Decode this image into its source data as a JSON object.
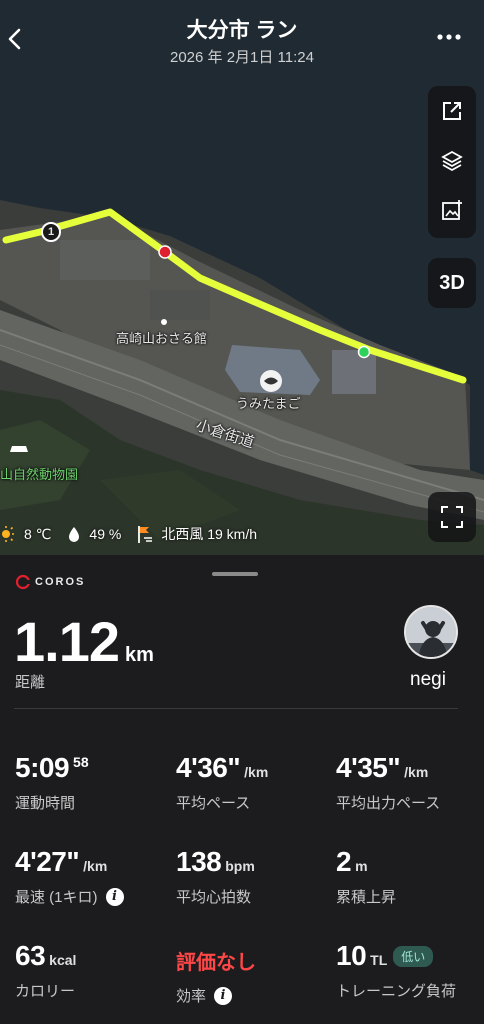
{
  "header": {
    "title": "大分市 ラン",
    "datetime": "2026 年 2月1日 11:24"
  },
  "map": {
    "labels": {
      "landmark": "高崎山おさる館",
      "aquarium": "うみたまご",
      "road": "小倉街道",
      "zoo": "山自然動物園"
    },
    "lap_marker": "1",
    "mode_button": "3D",
    "route_color": "#e6ff3b",
    "start_color": "#2ed25a",
    "end_color": "#e0202f"
  },
  "weather": {
    "temperature": "8 ℃",
    "humidity": "49 %",
    "wind": "北西風 19 km/h"
  },
  "panel": {
    "brand": "COROS",
    "distance": {
      "value": "1.12",
      "unit": "km",
      "label": "距離"
    },
    "user": {
      "name": "negi"
    },
    "stats": {
      "duration": {
        "value": "5:09",
        "sup": "58",
        "label": "運動時間"
      },
      "avg_pace": {
        "value": "4'36\"",
        "unit": "/km",
        "label": "平均ペース"
      },
      "avg_power_pace": {
        "value": "4'35\"",
        "unit": "/km",
        "label": "平均出力ペース"
      },
      "fastest": {
        "value": "4'27\"",
        "unit": "/km",
        "label": "最速 (1キロ)"
      },
      "avg_hr": {
        "value": "138",
        "unit": "bpm",
        "label": "平均心拍数"
      },
      "elevation": {
        "value": "2",
        "unit": "m",
        "label": "累積上昇"
      },
      "calories": {
        "value": "63",
        "unit": "kcal",
        "label": "カロリー"
      },
      "efficiency": {
        "value": "評価なし",
        "label": "効率"
      },
      "training_load": {
        "value": "10",
        "unit": "TL",
        "badge": "低い",
        "label": "トレーニング負荷"
      }
    }
  }
}
